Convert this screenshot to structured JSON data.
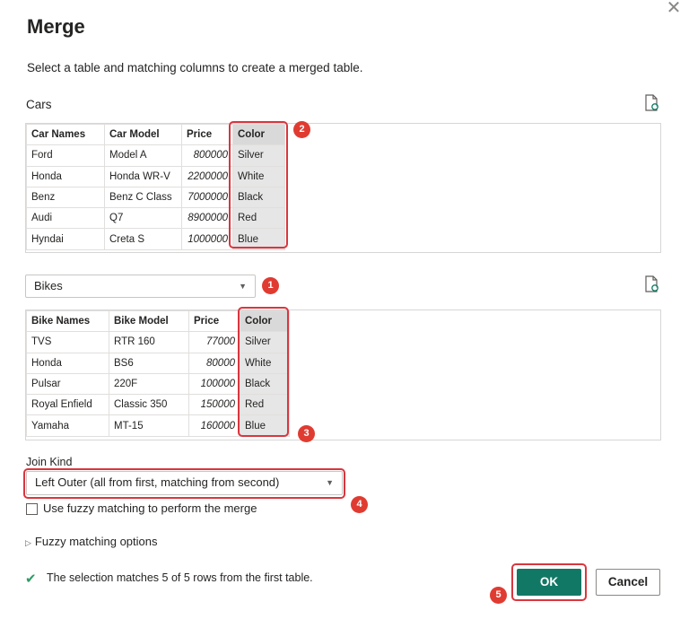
{
  "dialog": {
    "title": "Merge",
    "close_glyph": "✕",
    "subtitle": "Select a table and matching columns to create a merged table."
  },
  "first_table": {
    "name": "Cars",
    "columns": [
      "Car Names",
      "Car Model",
      "Price",
      "Color"
    ],
    "rows": [
      [
        "Ford",
        "Model A",
        "800000",
        "Silver"
      ],
      [
        "Honda",
        "Honda WR-V",
        "2200000",
        "White"
      ],
      [
        "Benz",
        "Benz C Class",
        "7000000",
        "Black"
      ],
      [
        "Audi",
        "Q7",
        "8900000",
        "Red"
      ],
      [
        "Hyndai",
        "Creta S",
        "1000000",
        "Blue"
      ]
    ]
  },
  "second_table": {
    "selected": "Bikes",
    "columns": [
      "Bike Names",
      "Bike Model",
      "Price",
      "Color"
    ],
    "rows": [
      [
        "TVS",
        "RTR 160",
        "77000",
        "Silver"
      ],
      [
        "Honda",
        "BS6",
        "80000",
        "White"
      ],
      [
        "Pulsar",
        "220F",
        "100000",
        "Black"
      ],
      [
        "Royal Enfield",
        "Classic 350",
        "150000",
        "Red"
      ],
      [
        "Yamaha",
        "MT-15",
        "160000",
        "Blue"
      ]
    ]
  },
  "join": {
    "label": "Join Kind",
    "selected": "Left Outer (all from first, matching from second)"
  },
  "fuzzy": {
    "checkbox_label": "Use fuzzy matching to perform the merge",
    "checked": false,
    "options_label": "Fuzzy matching options"
  },
  "status": {
    "text": "The selection matches 5 of 5 rows from the first table."
  },
  "buttons": {
    "ok": "OK",
    "cancel": "Cancel"
  },
  "annotations": [
    "1",
    "2",
    "3",
    "4",
    "5"
  ],
  "colors": {
    "accent": "#117865",
    "highlight": "#d9363e",
    "badge": "#e03b31",
    "success": "#2f9b66"
  },
  "icons": {
    "refresh": "refresh-preview-icon",
    "close": "close-icon",
    "check": "check-icon",
    "caret": "chevron-down-icon"
  }
}
